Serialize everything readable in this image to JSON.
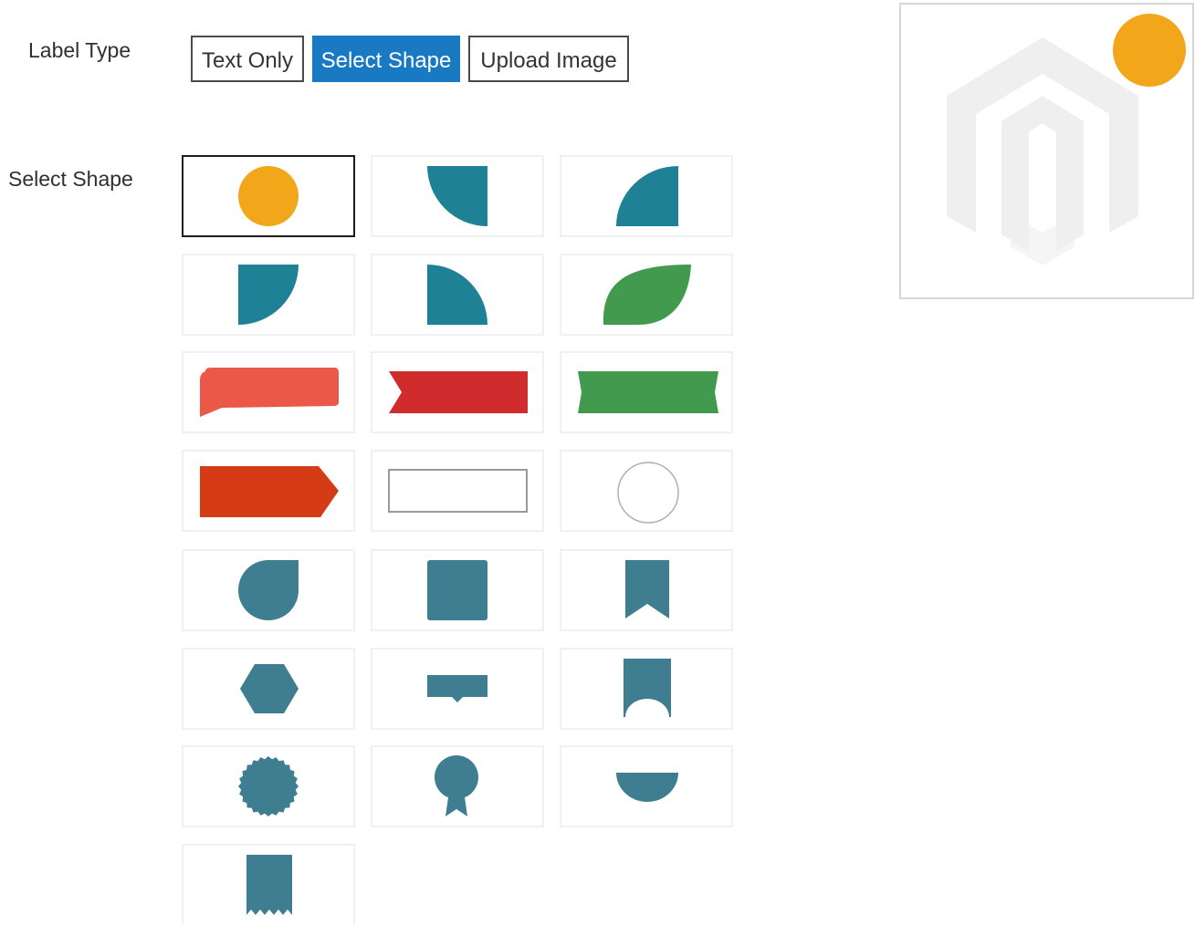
{
  "form": {
    "label_type_label": "Label Type",
    "select_shape_label": "Select Shape"
  },
  "label_type_options": [
    {
      "label": "Text Only",
      "active": false
    },
    {
      "label": "Select Shape",
      "active": true
    },
    {
      "label": "Upload Image",
      "active": false
    }
  ],
  "colors": {
    "accent_blue": "#1979c3",
    "orange": "#f2a71b",
    "teal": "#1f8196",
    "green": "#419a4e",
    "coral": "#ec5847",
    "red": "#d02c2e",
    "orange_red": "#d53c15",
    "slate": "#3f7d90"
  },
  "shapes": [
    {
      "name": "circle",
      "color": "orange",
      "selected": true
    },
    {
      "name": "quarter-circle-top-right",
      "color": "teal"
    },
    {
      "name": "quarter-circle-bottom-right",
      "color": "teal"
    },
    {
      "name": "quarter-circle-top-left",
      "color": "teal"
    },
    {
      "name": "quarter-circle-bottom-left",
      "color": "teal"
    },
    {
      "name": "leaf",
      "color": "green"
    },
    {
      "name": "speech-bubble",
      "color": "coral"
    },
    {
      "name": "ribbon-notch-left",
      "color": "red"
    },
    {
      "name": "ribbon-notch-both",
      "color": "green"
    },
    {
      "name": "arrow-tag",
      "color": "orange_red"
    },
    {
      "name": "outline-rectangle",
      "color": "gray"
    },
    {
      "name": "outline-circle",
      "color": "gray"
    },
    {
      "name": "teardrop",
      "color": "slate"
    },
    {
      "name": "rounded-square",
      "color": "slate"
    },
    {
      "name": "bookmark",
      "color": "slate"
    },
    {
      "name": "hexagon",
      "color": "slate"
    },
    {
      "name": "tag-pointer-down",
      "color": "slate"
    },
    {
      "name": "arch-bookmark",
      "color": "slate"
    },
    {
      "name": "starburst-seal",
      "color": "slate"
    },
    {
      "name": "award-badge",
      "color": "slate"
    },
    {
      "name": "half-circle",
      "color": "slate"
    },
    {
      "name": "zigzag-bookmark",
      "color": "slate"
    }
  ],
  "preview": {
    "shape": "circle",
    "color": "orange",
    "placeholder_icon": "magento-logo-placeholder"
  }
}
